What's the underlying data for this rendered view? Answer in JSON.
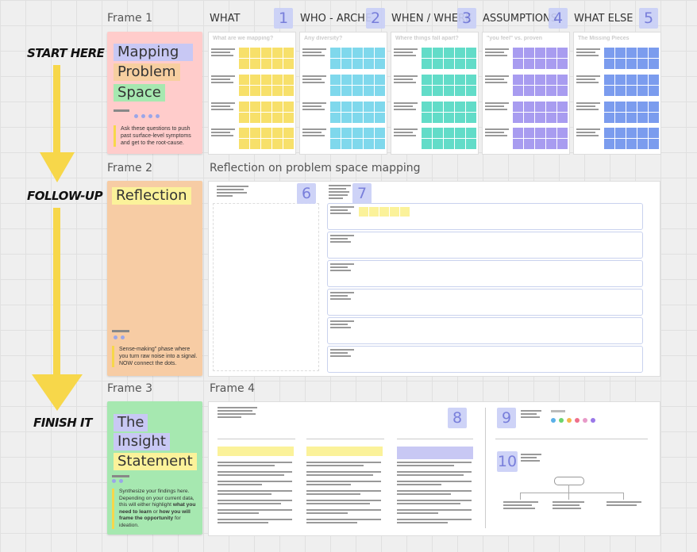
{
  "colors": {
    "yellow": "#f7d74a",
    "pink_card": "#ffcccb",
    "orange_card": "#f7cca4",
    "green_card": "#a6e8b0",
    "what": "#f7e06a",
    "who": "#7fd8ec",
    "when": "#62dcc8",
    "assumptions": "#a89cf0",
    "else": "#7b9cee",
    "badge": "#c9cff7"
  },
  "steps": {
    "start": "START HERE",
    "follow": "FOLLOW-UP",
    "finish": "FINISH IT"
  },
  "frames": {
    "frame1": "Frame 1",
    "frame2": "Frame 2",
    "frame3": "Frame 3",
    "frame4": "Frame 4"
  },
  "card1": {
    "title": [
      "Mapping",
      "Problem",
      "Space"
    ],
    "note": "Ask these questions to push past surface-level symptoms and get to the root-cause."
  },
  "card2": {
    "title": "Reflection",
    "note": "Sense-making\" phase where you turn raw noise into a signal. NOW connect the dots."
  },
  "card3": {
    "title": [
      "The",
      "Insight",
      "Statement"
    ],
    "note_pre": "Synthesize your findings here. Depending on your current data, this will either highlight ",
    "note_b1": "what you need to learn",
    "note_mid": " or ",
    "note_b2": "how you will frame the opportunity",
    "note_post": " for ideation."
  },
  "columns": [
    {
      "title": "WHAT",
      "badge": "1",
      "question": "What are we mapping?"
    },
    {
      "title": "WHO - ARCHE",
      "badge": "2",
      "question": "Any diversity?"
    },
    {
      "title": "WHEN / WHERE",
      "badge": "3",
      "question": "Where things fall apart?"
    },
    {
      "title": "ASSUMPTIONS",
      "badge": "4",
      "question": "\"you feel\" vs. proven"
    },
    {
      "title": "WHAT ELSE",
      "badge": "5",
      "question": "The Missing Pieces"
    }
  ],
  "reflection": {
    "title": "Reflection on problem space mapping",
    "badge6": "6",
    "badge7": "7"
  },
  "frame4": {
    "badge8": "8",
    "badge9": "9",
    "badge10": "10"
  }
}
